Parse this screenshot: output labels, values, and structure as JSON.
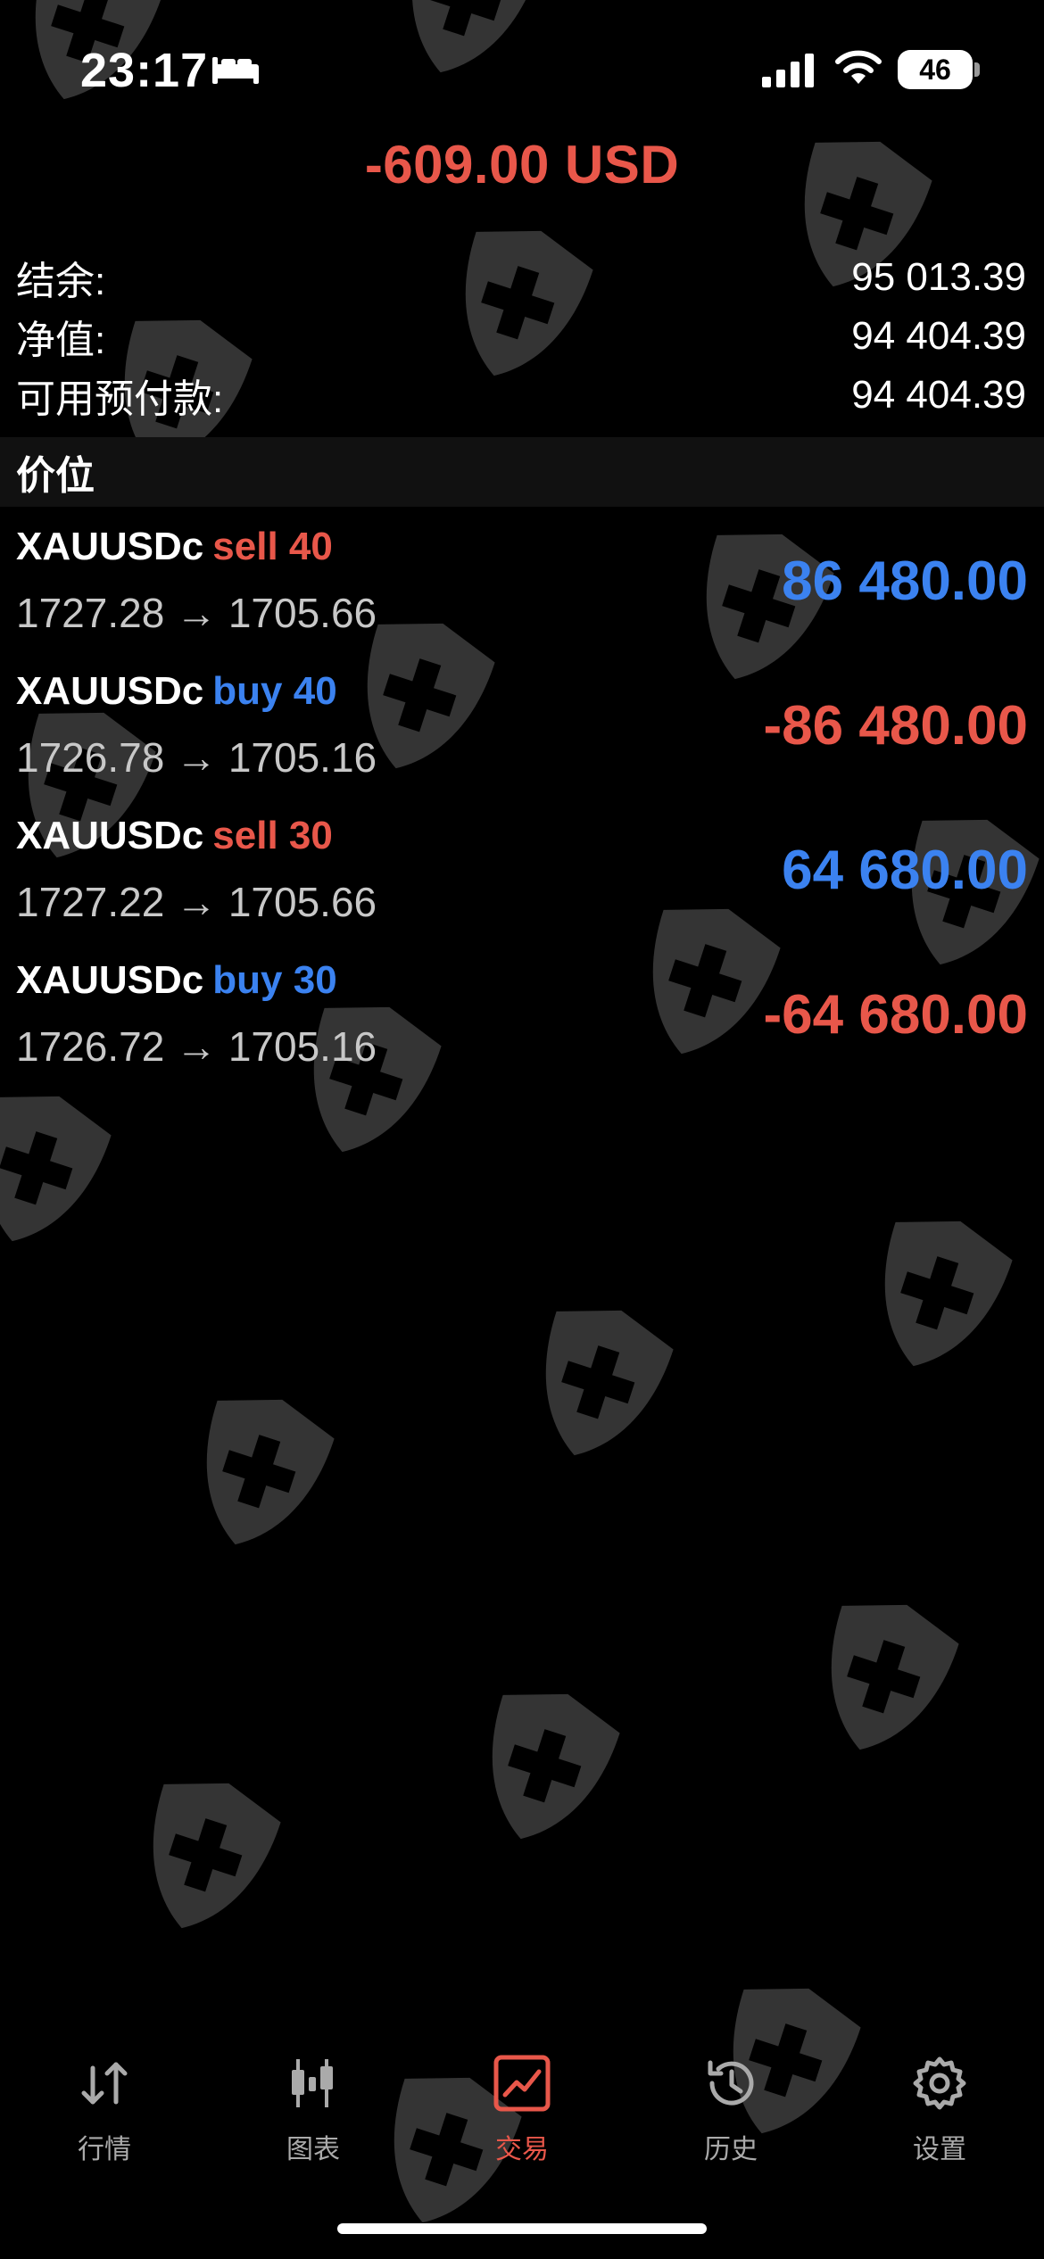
{
  "status_bar": {
    "time": "23:17",
    "battery": "46",
    "icons": [
      "sleep-icon",
      "signal-icon",
      "wifi-icon",
      "battery-icon"
    ]
  },
  "summary": {
    "total_profit": "-609.00 USD",
    "rows": [
      {
        "label": "结余:",
        "value": "95 013.39"
      },
      {
        "label": "净值:",
        "value": "94 404.39"
      },
      {
        "label": "可用预付款:",
        "value": "94 404.39"
      }
    ]
  },
  "positions_header": "价位",
  "positions": [
    {
      "symbol": "XAUUSDc",
      "type": "sell 40",
      "prices": "1727.28 → 1705.66",
      "profit": "86 480.00"
    },
    {
      "symbol": "XAUUSDc",
      "type": "buy 40",
      "prices": "1726.78 → 1705.16",
      "profit": "-86 480.00"
    },
    {
      "symbol": "XAUUSDc",
      "type": "sell 30",
      "prices": "1727.22 → 1705.66",
      "profit": "64 680.00"
    },
    {
      "symbol": "XAUUSDc",
      "type": "buy 30",
      "prices": "1726.72 → 1705.16",
      "profit": "-64 680.00"
    }
  ],
  "tabs": [
    {
      "label": "行情",
      "icon": "quotes-icon",
      "active": false
    },
    {
      "label": "图表",
      "icon": "chart-icon",
      "active": false
    },
    {
      "label": "交易",
      "icon": "trade-icon",
      "active": true
    },
    {
      "label": "历史",
      "icon": "history-icon",
      "active": false
    },
    {
      "label": "设置",
      "icon": "settings-icon",
      "active": false
    }
  ],
  "colors": {
    "negative": "#e8574a",
    "positive": "#3b82f0",
    "background": "#000000"
  }
}
